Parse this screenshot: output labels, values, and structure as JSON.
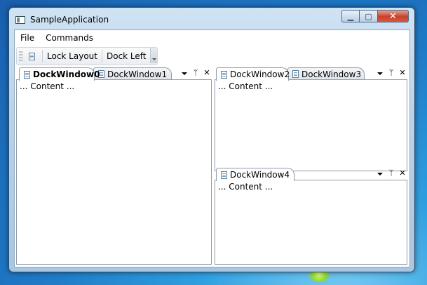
{
  "window": {
    "title": "SampleApplication",
    "controls": {
      "minimize": "▭",
      "maximize": "❐",
      "close": "✕"
    }
  },
  "menu": {
    "items": [
      "File",
      "Commands"
    ]
  },
  "toolbar": {
    "icon": "document-icon",
    "buttons": [
      "Lock Layout",
      "Dock Left"
    ]
  },
  "panes": [
    {
      "tabs": [
        "DockWindow0",
        "DockWindow1"
      ],
      "active": 0,
      "content": "... Content ..."
    },
    {
      "tabs": [
        "DockWindow2",
        "DockWindow3"
      ],
      "active": 0,
      "content": "... Content ..."
    },
    {
      "tabs": [
        "DockWindow4"
      ],
      "active": 0,
      "content": "... Content ..."
    }
  ],
  "pane_buttons": {
    "pin": "⸿",
    "close": "✕"
  },
  "colors": {
    "accent": "#1f7cc8",
    "close_button": "#c8402a"
  }
}
